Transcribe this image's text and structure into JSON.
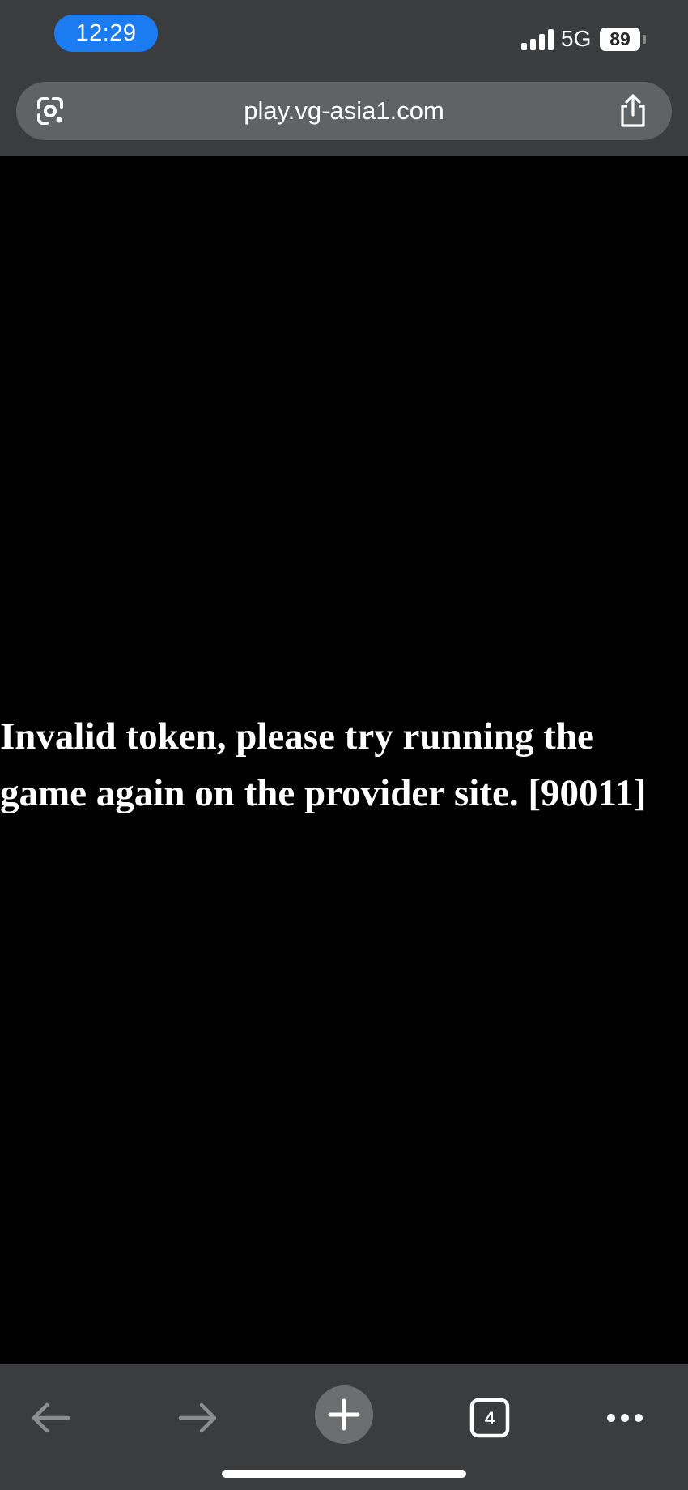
{
  "status_bar": {
    "time": "12:29",
    "network": "5G",
    "battery": "89"
  },
  "browser": {
    "url": "play.vg-asia1.com",
    "open_tabs": "4"
  },
  "page": {
    "error_message": "Invalid token, please try running the game again on the provider site. [90011]"
  },
  "colors": {
    "chrome": "#3a3c3e",
    "url_bar": "#606365",
    "time_pill": "#1a7cf0",
    "content_background": "#000000",
    "text": "#ffffff"
  },
  "icons": {
    "lens": "google-lens-icon",
    "share": "share-icon",
    "back": "arrow-left-icon",
    "forward": "arrow-right-icon",
    "new_tab": "plus-icon",
    "tabs": "tab-switcher-icon",
    "menu": "more-horizontal-icon"
  }
}
